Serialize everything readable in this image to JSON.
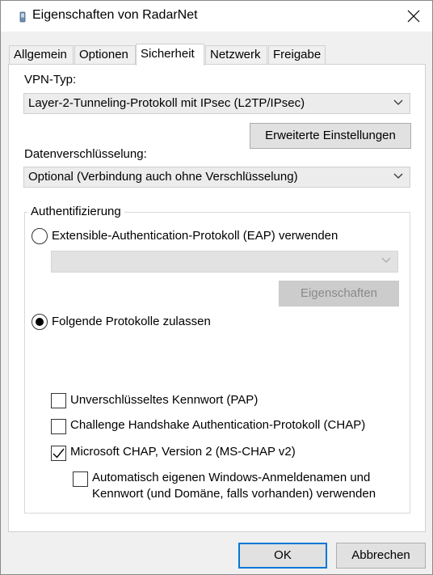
{
  "window": {
    "title": "Eigenschaften von RadarNet",
    "close_icon": "close-icon",
    "app_icon": "phone-icon"
  },
  "tabs": [
    {
      "label": "Allgemein"
    },
    {
      "label": "Optionen"
    },
    {
      "label": "Sicherheit",
      "active": true
    },
    {
      "label": "Netzwerk"
    },
    {
      "label": "Freigabe"
    }
  ],
  "security": {
    "vpn_type_label": "VPN-Typ:",
    "vpn_type_value": "Layer-2-Tunneling-Protokoll mit IPsec (L2TP/IPsec)",
    "advanced_button": "Erweiterte Einstellungen",
    "encryption_label": "Datenverschlüsselung:",
    "encryption_value": "Optional (Verbindung auch ohne Verschlüsselung)",
    "auth": {
      "legend": "Authentifizierung",
      "eap_radio_label": "Extensible-Authentication-Protokoll (EAP) verwenden",
      "eap_radio_selected": false,
      "eap_combo_value": "",
      "properties_button": "Eigenschaften",
      "protocols_radio_label": "Folgende Protokolle zulassen",
      "protocols_radio_selected": true,
      "checkboxes": [
        {
          "label": "Unverschlüsseltes Kennwort (PAP)",
          "checked": false
        },
        {
          "label": "Challenge Handshake Authentication-Protokoll (CHAP)",
          "checked": false
        },
        {
          "label": "Microsoft CHAP, Version 2 (MS-CHAP v2)",
          "checked": true
        }
      ],
      "auto_logon_line1": "Automatisch eigenen Windows-Anmeldenamen und",
      "auto_logon_line2": "Kennwort (und Domäne, falls vorhanden) verwenden",
      "auto_logon_checked": false
    }
  },
  "footer": {
    "ok_label": "OK",
    "cancel_label": "Abbrechen"
  },
  "colors": {
    "accent": "#0078d7",
    "panel": "#ffffff",
    "dialog": "#f0f0f0"
  }
}
